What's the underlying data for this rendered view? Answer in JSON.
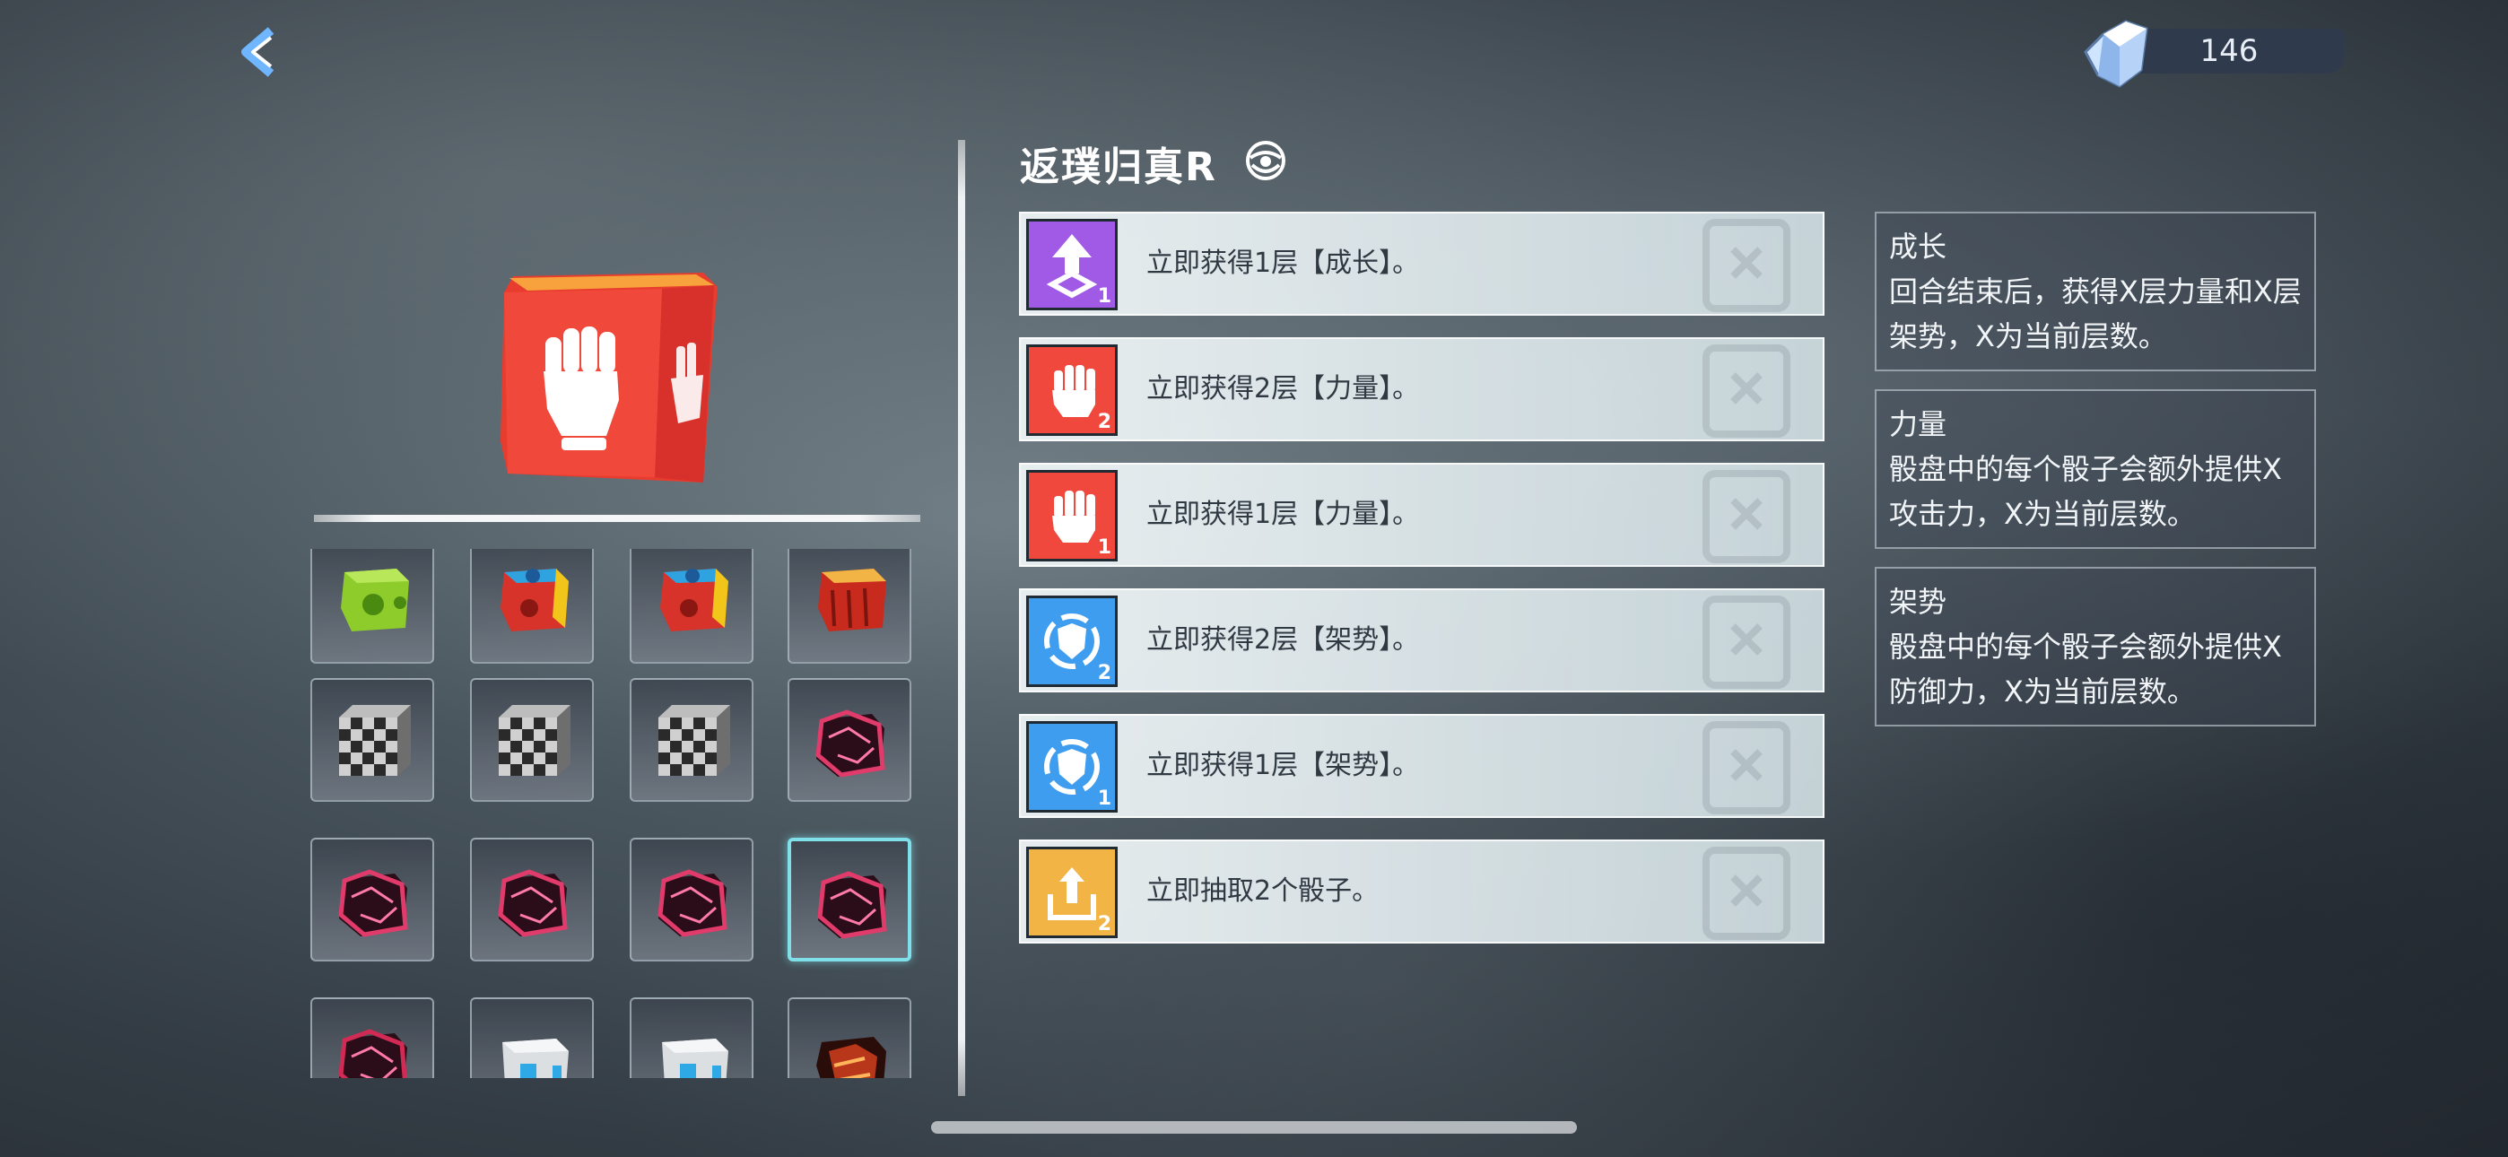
{
  "currency": {
    "icon": "crystal-gem-icon",
    "value": "146"
  },
  "dice": {
    "preview_icon": "fist-icon",
    "preview_color": "#f04b3a",
    "items": [
      {
        "name": "green-die",
        "color": "#8dcc2a"
      },
      {
        "name": "blue-red-die",
        "color": "#2fa3e0"
      },
      {
        "name": "blue-red-die",
        "color": "#2fa3e0"
      },
      {
        "name": "red-die",
        "color": "#c92a1e"
      },
      {
        "name": "checkered-die",
        "color": "#888888"
      },
      {
        "name": "checkered-die",
        "color": "#888888"
      },
      {
        "name": "checkered-die",
        "color": "#888888"
      },
      {
        "name": "crimson-die",
        "color": "#e13b6b"
      },
      {
        "name": "crimson-die",
        "color": "#e13b6b"
      },
      {
        "name": "crimson-die",
        "color": "#e13b6b"
      },
      {
        "name": "crimson-die",
        "color": "#e13b6b"
      },
      {
        "name": "crimson-die",
        "color": "#e13b6b",
        "selected": true
      },
      {
        "name": "crimson-die",
        "color": "#d12a55"
      },
      {
        "name": "white-die",
        "color": "#dcdfe2"
      },
      {
        "name": "white-die",
        "color": "#dcdfe2"
      },
      {
        "name": "lava-die",
        "color": "#b8361a"
      }
    ]
  },
  "detail": {
    "title": "返璞归真R",
    "effects": [
      {
        "icon": "growth-arrow-icon",
        "color": "#a05ae6",
        "level": "1",
        "text": "立即获得1层【成长】。"
      },
      {
        "icon": "fist-icon",
        "color": "#f0483c",
        "level": "2",
        "text": "立即获得2层【力量】。"
      },
      {
        "icon": "fist-icon",
        "color": "#f0483c",
        "level": "1",
        "text": "立即获得1层【力量】。"
      },
      {
        "icon": "shield-icon",
        "color": "#3f9df0",
        "level": "2",
        "text": "立即获得2层【架势】。"
      },
      {
        "icon": "shield-icon",
        "color": "#3f9df0",
        "level": "1",
        "text": "立即获得1层【架势】。"
      },
      {
        "icon": "draw-dice-icon",
        "color": "#f2b444",
        "level": "2",
        "text": "立即抽取2个骰子。"
      }
    ]
  },
  "glossary": [
    {
      "name": "成长",
      "desc": "回合结束后，获得X层力量和X层架势，X为当前层数。"
    },
    {
      "name": "力量",
      "desc": "骰盘中的每个骰子会额外提供X攻击力，X为当前层数。"
    },
    {
      "name": "架势",
      "desc": "骰盘中的每个骰子会额外提供X防御力，X为当前层数。"
    }
  ]
}
